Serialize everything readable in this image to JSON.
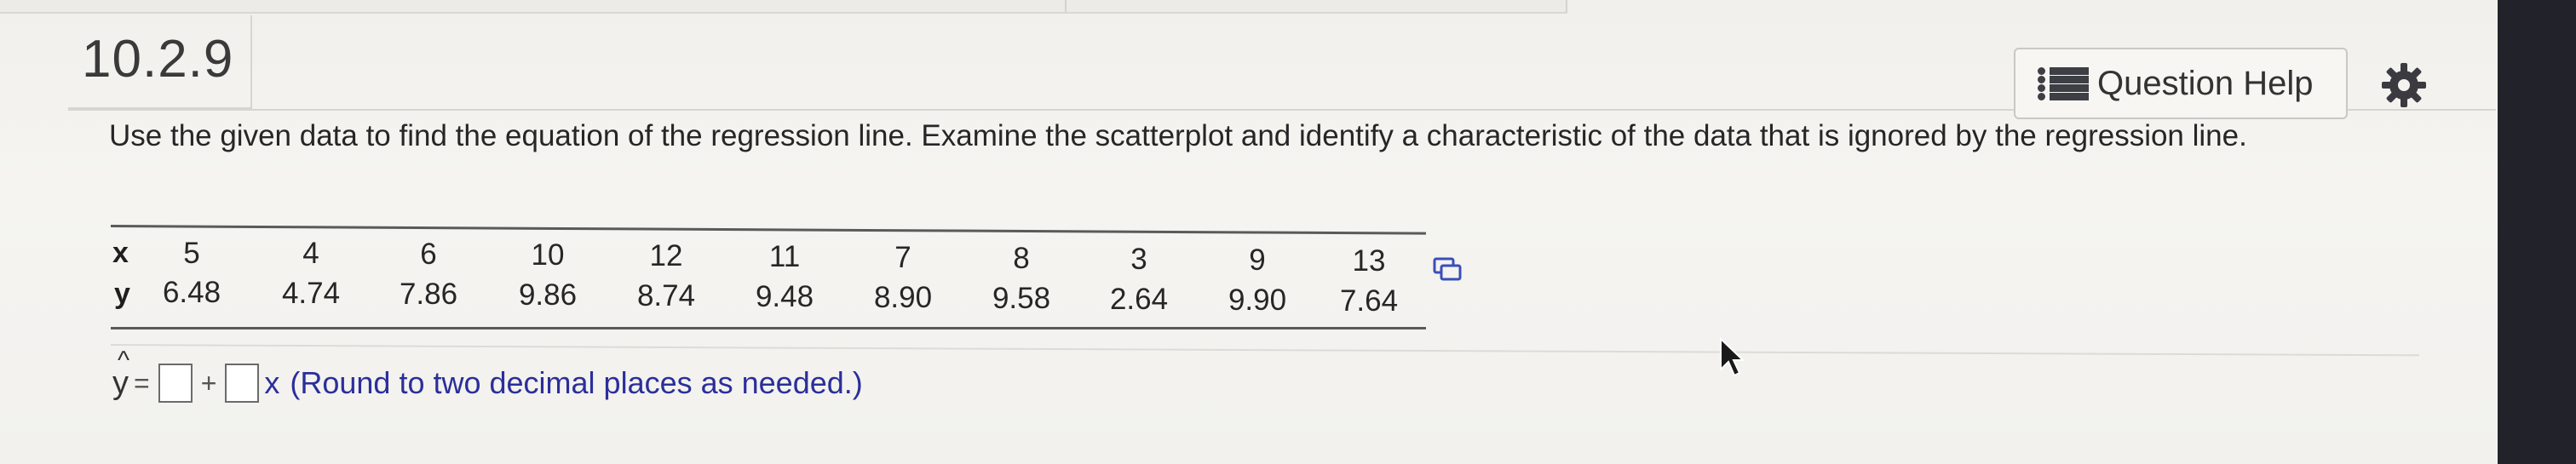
{
  "section_number": "10.2.9",
  "question_help": {
    "label": "Question Help",
    "icon": "list-icon"
  },
  "settings_icon": "gear-icon",
  "instructions": "Use the given data to find the equation of the regression line. Examine the scatterplot and identify a characteristic of the data that is ignored by the regression line.",
  "table": {
    "row_labels": [
      "x",
      "y"
    ],
    "x": [
      "5",
      "4",
      "6",
      "10",
      "12",
      "11",
      "7",
      "8",
      "3",
      "9",
      "13"
    ],
    "y": [
      "6.48",
      "4.74",
      "7.86",
      "9.86",
      "8.74",
      "9.48",
      "8.90",
      "9.58",
      "2.64",
      "9.90",
      "7.64"
    ],
    "copy_icon": "copy-icon"
  },
  "answer": {
    "y_symbol": "y",
    "hat_symbol": "^",
    "equals": "=",
    "plus": "+",
    "x_label": "x",
    "hint": "(Round to two decimal places as needed.)",
    "intercept_value": "",
    "slope_value": ""
  }
}
